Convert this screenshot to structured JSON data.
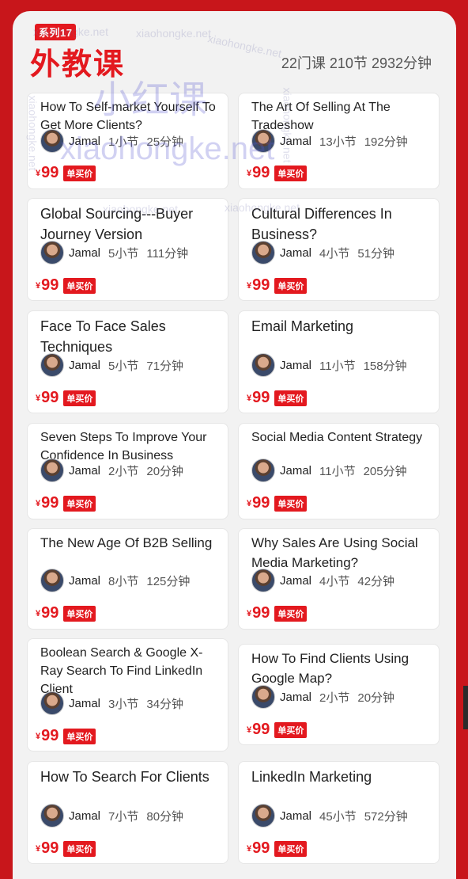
{
  "header": {
    "series_tag": "系列17",
    "title": "外教课",
    "stats": "22门课 210节 2932分钟"
  },
  "watermark": {
    "text": "xiaohongke.net",
    "big_cn": "小红课",
    "big_en": "xiaohongke.net"
  },
  "price": {
    "currency": "¥",
    "amount": "99",
    "tag": "单买价"
  },
  "courses": [
    {
      "title": "How To Self-market Yourself To Get More Clients?",
      "author": "Jamal",
      "sections": "1小节",
      "duration": "25分钟"
    },
    {
      "title": "The Art Of Selling At The Tradeshow",
      "author": "Jamal",
      "sections": "13小节",
      "duration": "192分钟"
    },
    {
      "title": "Global Sourcing---Buyer Journey Version",
      "author": "Jamal",
      "sections": "5小节",
      "duration": "111分钟"
    },
    {
      "title": "Cultural Differences In Business?",
      "author": "Jamal",
      "sections": "4小节",
      "duration": "51分钟"
    },
    {
      "title": "Face To Face Sales Techniques",
      "author": "Jamal",
      "sections": "5小节",
      "duration": "71分钟"
    },
    {
      "title": "Email Marketing",
      "author": "Jamal",
      "sections": "11小节",
      "duration": "158分钟"
    },
    {
      "title": "Seven Steps To Improve Your Confidence In Business",
      "author": "Jamal",
      "sections": "2小节",
      "duration": "20分钟"
    },
    {
      "title": "Social Media Content Strategy",
      "author": "Jamal",
      "sections": "11小节",
      "duration": "205分钟"
    },
    {
      "title": "The New Age Of B2B Selling",
      "author": "Jamal",
      "sections": "8小节",
      "duration": "125分钟"
    },
    {
      "title": "Why Sales Are Using Social Media Marketing?",
      "author": "Jamal",
      "sections": "4小节",
      "duration": "42分钟"
    },
    {
      "title": "Boolean Search & Google X-Ray Search To Find LinkedIn Client",
      "author": "Jamal",
      "sections": "3小节",
      "duration": "34分钟"
    },
    {
      "title": "How To Find Clients Using Google Map?",
      "author": "Jamal",
      "sections": "2小节",
      "duration": "20分钟"
    },
    {
      "title": "How To Search For Clients",
      "author": "Jamal",
      "sections": "7小节",
      "duration": "80分钟"
    },
    {
      "title": "LinkedIn Marketing",
      "author": "Jamal",
      "sections": "45小节",
      "duration": "572分钟"
    }
  ]
}
